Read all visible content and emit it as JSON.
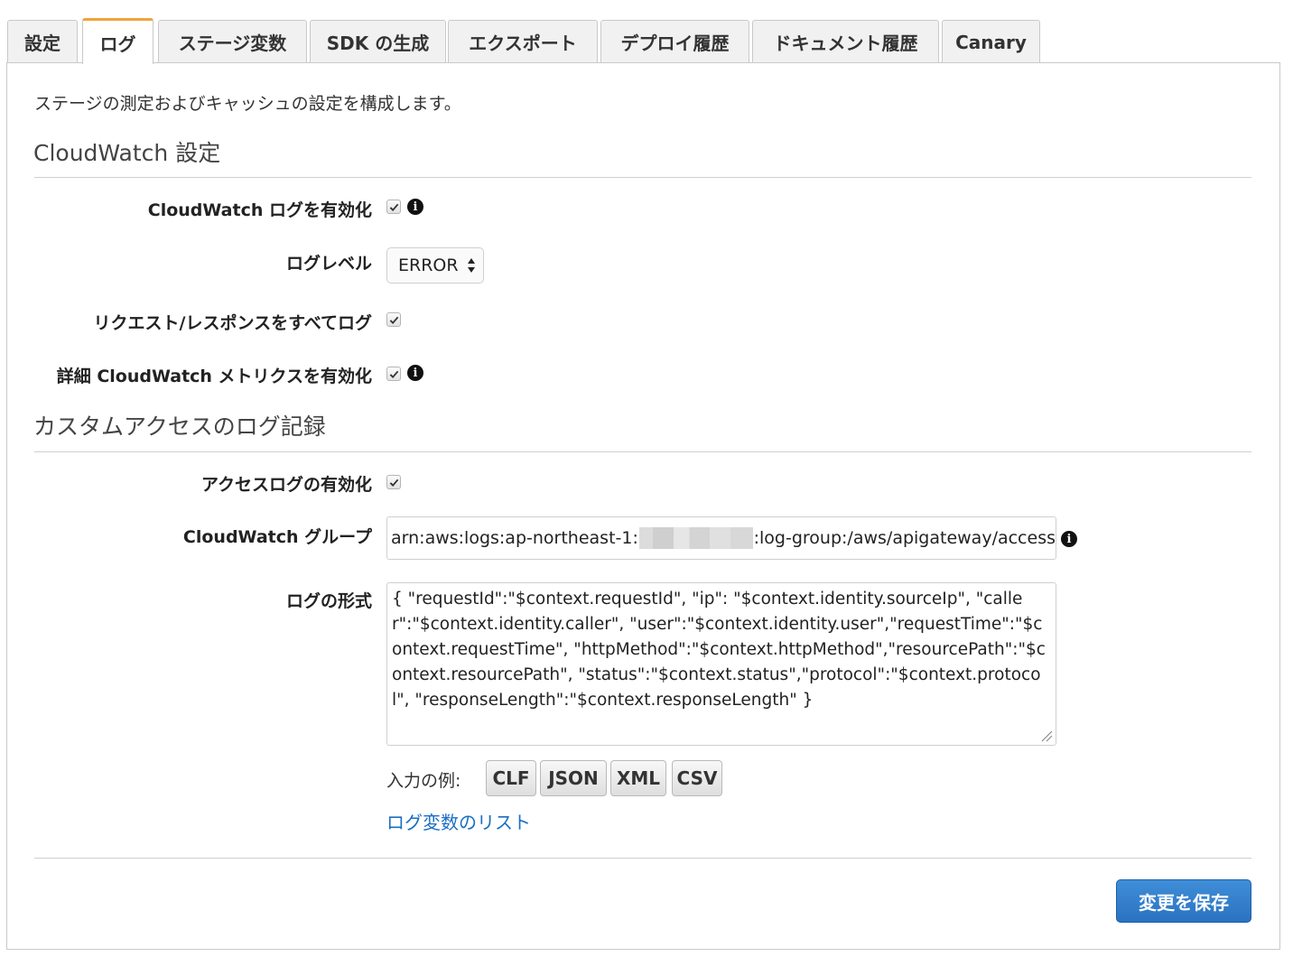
{
  "tabs": [
    {
      "label": "設定",
      "active": false
    },
    {
      "label": "ログ",
      "active": true
    },
    {
      "label": "ステージ変数",
      "active": false
    },
    {
      "label": "SDK の生成",
      "active": false
    },
    {
      "label": "エクスポート",
      "active": false
    },
    {
      "label": "デプロイ履歴",
      "active": false
    },
    {
      "label": "ドキュメント履歴",
      "active": false
    },
    {
      "label": "Canary",
      "active": false
    }
  ],
  "intro": "ステージの測定およびキャッシュの設定を構成します。",
  "cloudwatch": {
    "title": "CloudWatch 設定",
    "enable_logs_label": "CloudWatch ログを有効化",
    "enable_logs_checked": true,
    "log_level_label": "ログレベル",
    "log_level_value": "ERROR",
    "log_full_label": "リクエスト/レスポンスをすべてログ",
    "log_full_checked": true,
    "detailed_metrics_label": "詳細 CloudWatch メトリクスを有効化",
    "detailed_metrics_checked": true
  },
  "access_logging": {
    "title": "カスタムアクセスのログ記録",
    "enable_label": "アクセスログの有効化",
    "enable_checked": true,
    "group_label": "CloudWatch グループ",
    "group_value_prefix": "arn:aws:logs:ap-northeast-1:",
    "group_value_suffix": ":log-group:/aws/apigateway/access",
    "format_label": "ログの形式",
    "format_value": "{ \"requestId\":\"$context.requestId\", \"ip\": \"$context.identity.sourceIp\", \"caller\":\"$context.identity.caller\", \"user\":\"$context.identity.user\",\"requestTime\":\"$context.requestTime\", \"httpMethod\":\"$context.httpMethod\",\"resourcePath\":\"$context.resourcePath\", \"status\":\"$context.status\",\"protocol\":\"$context.protocol\", \"responseLength\":\"$context.responseLength\" }",
    "examples_label": "入力の例:",
    "examples": [
      "CLF",
      "JSON",
      "XML",
      "CSV"
    ],
    "variables_link": "ログ変数のリスト"
  },
  "save_button": "変更を保存",
  "colors": {
    "accent_tab": "#f0a33a",
    "link": "#1a6fc4",
    "primary_button": "#2a72c1"
  }
}
